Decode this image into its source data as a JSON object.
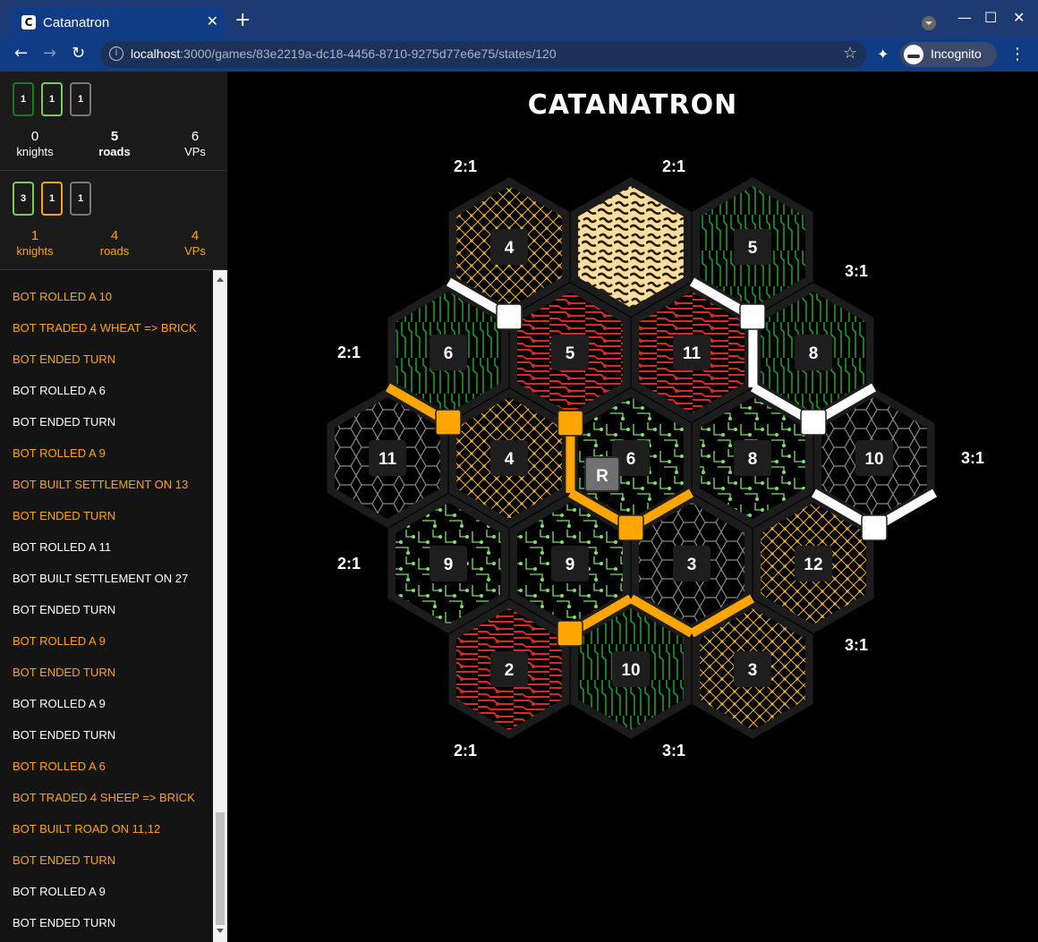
{
  "browser": {
    "tab_title": "Catanatron",
    "tab_icon": "C",
    "url_host": "localhost",
    "url_path": ":3000/games/83e2219a-dc18-4456-8710-9275d77e6e75/states/120",
    "profile_label": "Incognito"
  },
  "players": [
    {
      "color": "#ffffff",
      "cards": [
        {
          "value": "1",
          "color": "green"
        },
        {
          "value": "1",
          "color": "lgreen"
        },
        {
          "value": "1",
          "color": "gray"
        }
      ],
      "knights": "0",
      "knights_label": "knights",
      "roads": "5",
      "roads_label": "roads",
      "vps": "6",
      "vps_label": "VPs"
    },
    {
      "color": "#ffa500",
      "cards": [
        {
          "value": "3",
          "color": "lgreen"
        },
        {
          "value": "1",
          "color": "orange"
        },
        {
          "value": "1",
          "color": "gray"
        }
      ],
      "knights": "1",
      "knights_label": "knights",
      "roads": "4",
      "roads_label": "roads",
      "vps": "4",
      "vps_label": "VPs"
    }
  ],
  "log": [
    {
      "text": "BOT ROLLED A 10",
      "player": "orange"
    },
    {
      "text": "BOT TRADED 4 WHEAT => BRICK",
      "player": "orange"
    },
    {
      "text": "BOT ENDED TURN",
      "player": "orange"
    },
    {
      "text": "BOT ROLLED A 6",
      "player": "white"
    },
    {
      "text": "BOT ENDED TURN",
      "player": "white"
    },
    {
      "text": "BOT ROLLED A 9",
      "player": "orange"
    },
    {
      "text": "BOT BUILT SETTLEMENT ON 13",
      "player": "orange"
    },
    {
      "text": "BOT ENDED TURN",
      "player": "orange"
    },
    {
      "text": "BOT ROLLED A 11",
      "player": "white"
    },
    {
      "text": "BOT BUILT SETTLEMENT ON 27",
      "player": "white"
    },
    {
      "text": "BOT ENDED TURN",
      "player": "white"
    },
    {
      "text": "BOT ROLLED A 9",
      "player": "orange"
    },
    {
      "text": "BOT ENDED TURN",
      "player": "orange"
    },
    {
      "text": "BOT ROLLED A 9",
      "player": "white"
    },
    {
      "text": "BOT ENDED TURN",
      "player": "white"
    },
    {
      "text": "BOT ROLLED A 6",
      "player": "orange"
    },
    {
      "text": "BOT TRADED 4 SHEEP => BRICK",
      "player": "orange"
    },
    {
      "text": "BOT BUILT ROAD ON 11,12",
      "player": "orange"
    },
    {
      "text": "BOT ENDED TURN",
      "player": "orange"
    },
    {
      "text": "BOT ROLLED A 9",
      "player": "white"
    },
    {
      "text": "BOT ENDED TURN",
      "player": "white"
    }
  ],
  "game": {
    "title": "CATANATRON",
    "robber_label": "R",
    "tiles": [
      {
        "q": 0,
        "r": -2,
        "resource": "wheat",
        "number": "4"
      },
      {
        "q": 1,
        "r": -2,
        "resource": "desert",
        "number": ""
      },
      {
        "q": 2,
        "r": -2,
        "resource": "wood",
        "number": "5"
      },
      {
        "q": -1,
        "r": -1,
        "resource": "wood",
        "number": "6"
      },
      {
        "q": 0,
        "r": -1,
        "resource": "brick",
        "number": "5"
      },
      {
        "q": 1,
        "r": -1,
        "resource": "brick",
        "number": "11"
      },
      {
        "q": 2,
        "r": -1,
        "resource": "wood",
        "number": "8"
      },
      {
        "q": -2,
        "r": 0,
        "resource": "ore",
        "number": "11"
      },
      {
        "q": -1,
        "r": 0,
        "resource": "wheat",
        "number": "4"
      },
      {
        "q": 0,
        "r": 0,
        "resource": "sheep",
        "number": "6"
      },
      {
        "q": 1,
        "r": 0,
        "resource": "sheep",
        "number": "8"
      },
      {
        "q": 2,
        "r": 0,
        "resource": "ore",
        "number": "10"
      },
      {
        "q": -2,
        "r": 1,
        "resource": "sheep",
        "number": "9"
      },
      {
        "q": -1,
        "r": 1,
        "resource": "sheep",
        "number": "9"
      },
      {
        "q": 0,
        "r": 1,
        "resource": "ore",
        "number": "3"
      },
      {
        "q": 1,
        "r": 1,
        "resource": "wheat",
        "number": "12"
      },
      {
        "q": -2,
        "r": 2,
        "resource": "brick",
        "number": "2"
      },
      {
        "q": -1,
        "r": 2,
        "resource": "wood",
        "number": "10"
      },
      {
        "q": 0,
        "r": 2,
        "resource": "wheat",
        "number": "3"
      }
    ],
    "ports": [
      {
        "label": "2:1",
        "anchor": "top-left"
      },
      {
        "label": "2:1",
        "anchor": "top-right"
      },
      {
        "label": "3:1",
        "anchor": "right-upper"
      },
      {
        "label": "2:1",
        "anchor": "left-upper"
      },
      {
        "label": "3:1",
        "anchor": "right"
      },
      {
        "label": "2:1",
        "anchor": "left-lower"
      },
      {
        "label": "3:1",
        "anchor": "right-lower"
      },
      {
        "label": "2:1",
        "anchor": "bottom-left"
      },
      {
        "label": "3:1",
        "anchor": "bottom-right"
      }
    ]
  },
  "colors": {
    "orange_player": "#ffa500",
    "white_player": "#ffffff",
    "wheat": "#f2b82c",
    "wood": "#1d9a2a",
    "brick": "#d62b1e",
    "sheep": "#7ee06a",
    "ore": "#9a9a9a",
    "desert": "#f5deA0"
  }
}
